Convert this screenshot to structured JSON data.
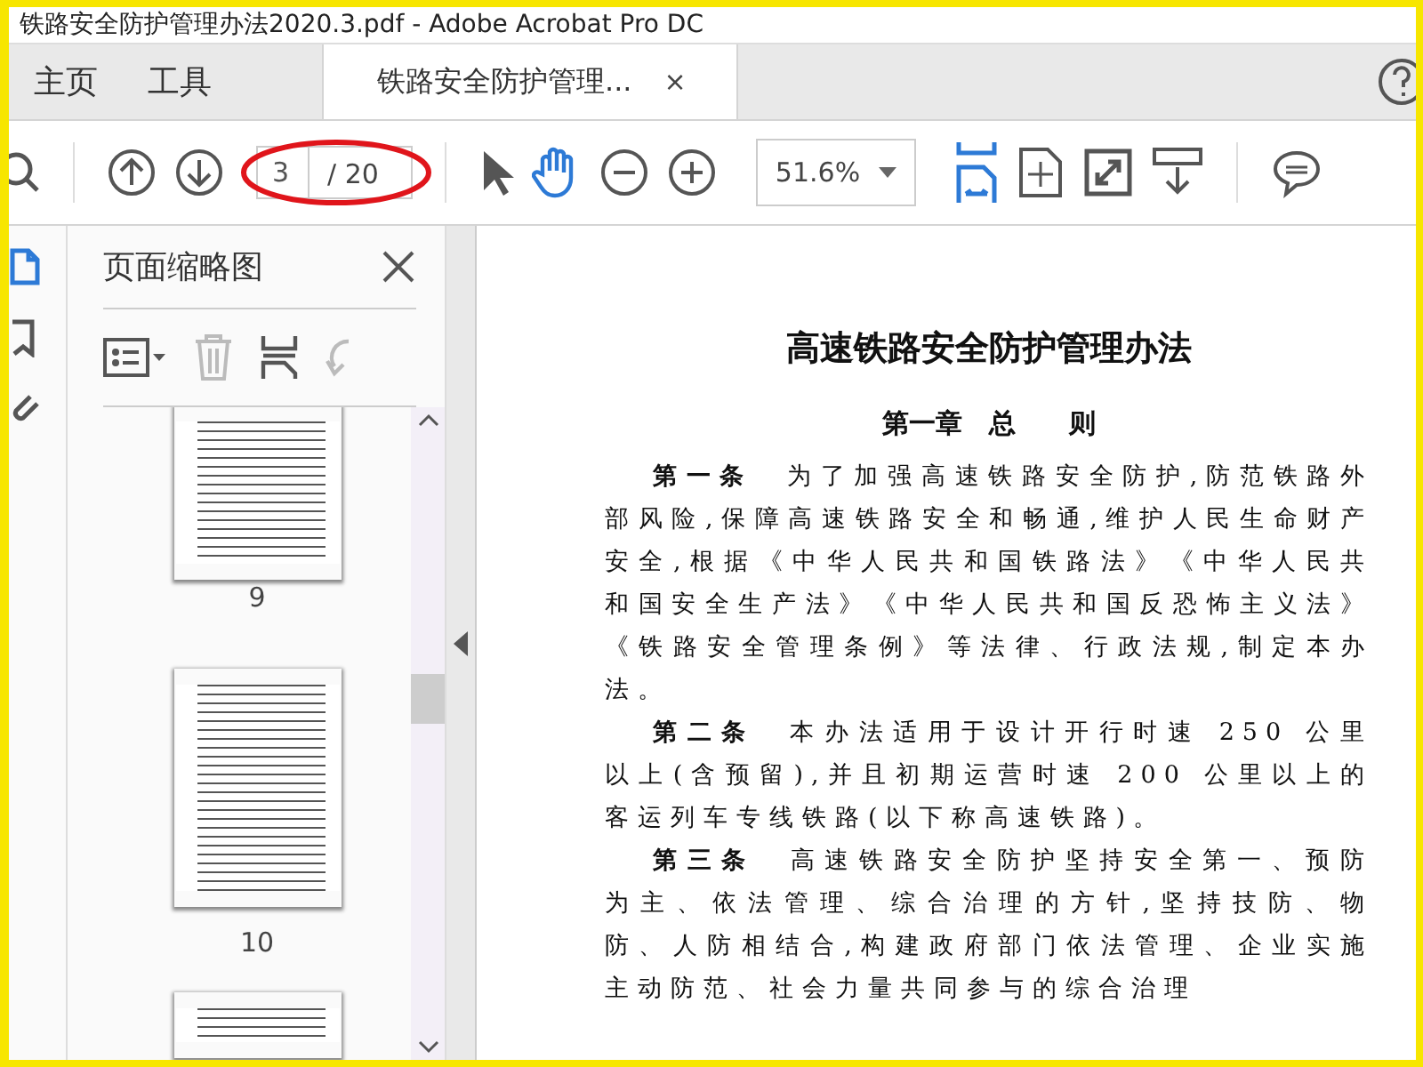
{
  "window": {
    "title": "铁路安全防护管理办法2020.3.pdf - Adobe Acrobat Pro DC"
  },
  "tabs": [
    {
      "label": "主页",
      "selected": false
    },
    {
      "label": "工具",
      "selected": false
    },
    {
      "label": "铁路安全防护管理...",
      "selected": true,
      "close": "×"
    }
  ],
  "toolbar": {
    "page_value": "3",
    "page_total": "/ 20",
    "zoom": "51.6%"
  },
  "side_rail": [
    {
      "kind": "pages",
      "selected": true
    },
    {
      "kind": "bookmarks",
      "selected": false
    },
    {
      "kind": "attachments",
      "selected": false
    }
  ],
  "thumbnails_panel": {
    "title": "页面缩略图",
    "thumbnails": [
      {
        "label": "9"
      },
      {
        "label": "10"
      }
    ]
  },
  "document": {
    "title": "高速铁路安全防护管理办法",
    "chapter": "第一章　总　　则",
    "paragraphs": [
      "**第一条**　为了加强高速铁路安全防护,防范铁路外部风险,保障高速铁路安全和畅通,维护人民生命财产安全,根据《中华人民共和国铁路法》《中华人民共和国安全生产法》《中华人民共和国反恐怖主义法》《铁路安全管理条例》等法律、行政法规,制定本办法。",
      "**第二条**　本办法适用于设计开行时速 250 公里以上(含预留),并且初期运营时速 200 公里以上的客运列车专线铁路(以下称高速铁路)。",
      "**第三条**　高速铁路安全防护坚持安全第一、预防为主、依法管理、综合治理的方针,坚持技防、物防、人防相结合,构建政府部门依法管理、企业实施主动防范、社会力量共同参与的综合治理"
    ]
  }
}
